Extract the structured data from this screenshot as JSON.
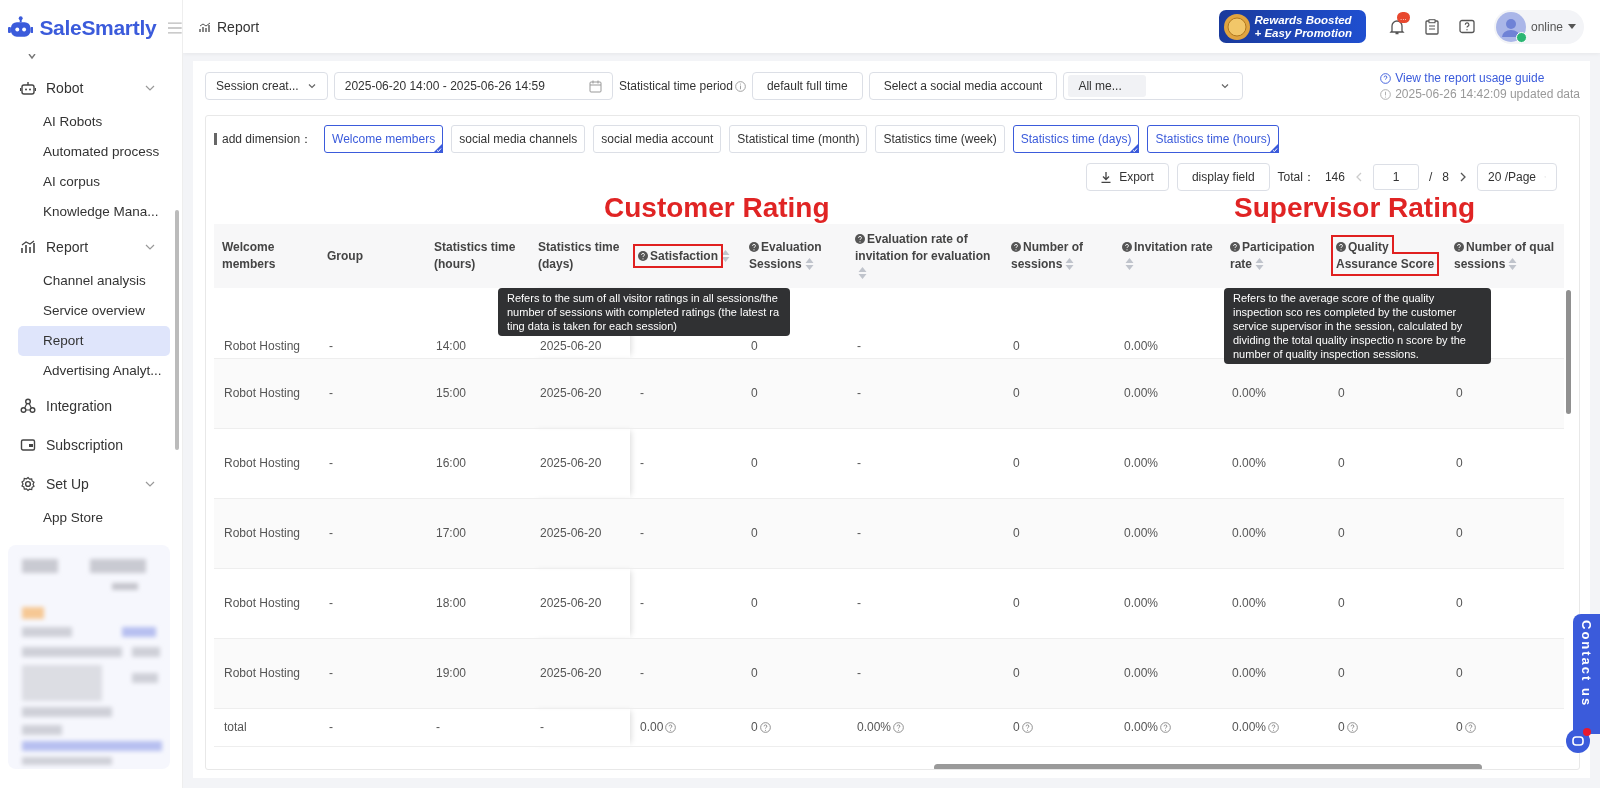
{
  "brand": {
    "name": "SaleSmartly"
  },
  "sidebar": {
    "items": [
      {
        "label": "Robot",
        "expanded": true,
        "children": [
          {
            "label": "AI Robots",
            "selected": false
          },
          {
            "label": "Automated process",
            "selected": false
          },
          {
            "label": "AI corpus",
            "selected": false
          },
          {
            "label": "Knowledge Mana...",
            "selected": false
          }
        ]
      },
      {
        "label": "Report",
        "expanded": true,
        "children": [
          {
            "label": "Channel analysis",
            "selected": false
          },
          {
            "label": "Service overview",
            "selected": false
          },
          {
            "label": "Report",
            "selected": true
          },
          {
            "label": "Advertising Analyt...",
            "selected": false
          }
        ]
      },
      {
        "label": "Integration"
      },
      {
        "label": "Subscription"
      },
      {
        "label": "Set Up",
        "expanded": true,
        "children": [
          {
            "label": "App Store",
            "selected": false
          }
        ]
      }
    ]
  },
  "header": {
    "page_title": "Report",
    "promo": [
      "Rewards Boosted",
      "+ Easy Promotion"
    ],
    "notification_badge": "...",
    "status": "online"
  },
  "filters": {
    "time_type": "Session creat...",
    "date_range": "2025-06-20 14:00 - 2025-06-26 14:59",
    "period_label": "Statistical time period",
    "period_value": "default full time",
    "account_button": "Select a social media account",
    "member_select": "All me...",
    "guide_link": "View the report usage guide",
    "updated": "2025-06-26 14:42:09 updated data"
  },
  "dimensions": {
    "label": "add dimension：",
    "chips": [
      {
        "label": "Welcome members",
        "selected": true
      },
      {
        "label": "social media channels",
        "selected": false
      },
      {
        "label": "social media account",
        "selected": false
      },
      {
        "label": "Statistical time (month)",
        "selected": false
      },
      {
        "label": "Statistics time (week)",
        "selected": false
      },
      {
        "label": "Statistics time (days)",
        "selected": true
      },
      {
        "label": "Statistics time (hours)",
        "selected": true
      }
    ]
  },
  "toolbar": {
    "export": "Export",
    "display_field": "display field",
    "total_label": "Total：",
    "total": "146",
    "page": "1",
    "page_separator": "/",
    "pages": "8",
    "page_size": "20 /Page"
  },
  "table": {
    "columns": [
      {
        "label": "Welcome members",
        "help": false,
        "sortable": false,
        "highlighted": false
      },
      {
        "label": "Group",
        "help": false,
        "sortable": false,
        "highlighted": false
      },
      {
        "label": "Statistics time (hours)",
        "help": false,
        "sortable": false,
        "highlighted": false
      },
      {
        "label": "Statistics time (days)",
        "help": false,
        "sortable": false,
        "highlighted": false
      },
      {
        "label": "Satisfaction",
        "help": true,
        "sortable": true,
        "highlighted": true
      },
      {
        "label": "Evaluation Sessions",
        "help": true,
        "sortable": true,
        "highlighted": false
      },
      {
        "label": "Evaluation rate of invitation for evaluation",
        "help": true,
        "sortable": true,
        "highlighted": false
      },
      {
        "label": "Number of sessions",
        "help": true,
        "sortable": true,
        "highlighted": false
      },
      {
        "label": "Invitation rate",
        "help": true,
        "sortable": true,
        "highlighted": false
      },
      {
        "label": "Participation rate",
        "help": true,
        "sortable": true,
        "highlighted": false
      },
      {
        "label": "Quality Assurance Score",
        "help": true,
        "sortable": false,
        "highlighted": true
      },
      {
        "label": "Number of qual sessions",
        "help": true,
        "sortable": true,
        "highlighted": false
      }
    ],
    "rows": [
      [
        "Robot Hosting",
        "-",
        "14:00",
        "2025-06-20",
        null,
        "0",
        "-",
        "0",
        "0.00%",
        null,
        null,
        null
      ],
      [
        "Robot Hosting",
        "-",
        "15:00",
        "2025-06-20",
        "-",
        "0",
        "-",
        "0",
        "0.00%",
        "0.00%",
        "0",
        "0"
      ],
      [
        "Robot Hosting",
        "-",
        "16:00",
        "2025-06-20",
        "-",
        "0",
        "-",
        "0",
        "0.00%",
        "0.00%",
        "0",
        "0"
      ],
      [
        "Robot Hosting",
        "-",
        "17:00",
        "2025-06-20",
        "-",
        "0",
        "-",
        "0",
        "0.00%",
        "0.00%",
        "0",
        "0"
      ],
      [
        "Robot Hosting",
        "-",
        "18:00",
        "2025-06-20",
        "-",
        "0",
        "-",
        "0",
        "0.00%",
        "0.00%",
        "0",
        "0"
      ],
      [
        "Robot Hosting",
        "-",
        "19:00",
        "2025-06-20",
        "-",
        "0",
        "-",
        "0",
        "0.00%",
        "0.00%",
        "0",
        "0"
      ]
    ],
    "total_row": [
      {
        "text": "total",
        "help": false
      },
      {
        "text": "-",
        "help": false
      },
      {
        "text": "-",
        "help": false
      },
      {
        "text": "-",
        "help": false
      },
      {
        "text": "0.00",
        "help": true
      },
      {
        "text": "0",
        "help": true
      },
      {
        "text": "0.00%",
        "help": true
      },
      {
        "text": "0",
        "help": true
      },
      {
        "text": "0.00%",
        "help": true
      },
      {
        "text": "0.00%",
        "help": true
      },
      {
        "text": "0",
        "help": true
      },
      {
        "text": "0",
        "help": true
      }
    ]
  },
  "annotations": [
    {
      "text": "Customer Rating"
    },
    {
      "text": "Supervisor Rating"
    }
  ],
  "tooltips": [
    {
      "text": "Refers to the sum of all visitor ratings in all sessions/the number of sessions with completed ratings (the latest ra ting data is taken for each session)"
    },
    {
      "text": "Refers to the average score of the quality inspection sco res completed by the customer service supervisor in the session, calculated by dividing the total quality inspectio n score by the number of quality inspection sessions."
    }
  ],
  "contact": {
    "label": "Contact us"
  }
}
